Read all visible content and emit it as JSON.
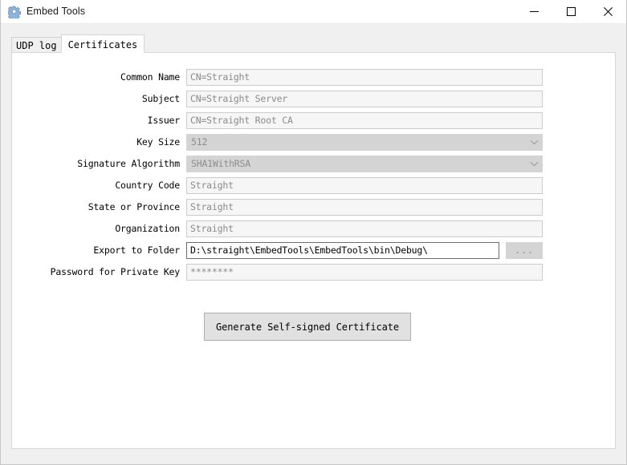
{
  "window": {
    "title": "Embed Tools",
    "icon": "gear-icon",
    "controls": {
      "minimize": "minimize-icon",
      "maximize": "maximize-icon",
      "close": "close-icon"
    }
  },
  "tabs": [
    {
      "label": "UDP log",
      "active": false
    },
    {
      "label": "Certificates",
      "active": true
    }
  ],
  "form": {
    "rows": [
      {
        "label": "Common Name",
        "type": "text",
        "value": "CN=Straight",
        "enabled": false
      },
      {
        "label": "Subject",
        "type": "text",
        "value": "CN=Straight Server",
        "enabled": false
      },
      {
        "label": "Issuer",
        "type": "text",
        "value": "CN=Straight Root CA",
        "enabled": false
      },
      {
        "label": "Key Size",
        "type": "combo",
        "value": "512",
        "enabled": false
      },
      {
        "label": "Signature Algorithm",
        "type": "combo",
        "value": "SHA1WithRSA",
        "enabled": false
      },
      {
        "label": "Country Code",
        "type": "text",
        "value": "Straight",
        "enabled": false
      },
      {
        "label": "State or Province",
        "type": "text",
        "value": "Straight",
        "enabled": false
      },
      {
        "label": "Organization",
        "type": "text",
        "value": "Straight",
        "enabled": false
      },
      {
        "label": "Export to Folder",
        "type": "path",
        "value": "D:\\straight\\EmbedTools\\EmbedTools\\bin\\Debug\\",
        "enabled": true,
        "browse_label": "..."
      },
      {
        "label": "Password for Private Key",
        "type": "password",
        "value": "********",
        "enabled": false
      }
    ],
    "generate_button": "Generate Self-signed Certificate"
  },
  "colors": {
    "window_bg": "#f0f0f0",
    "panel_bg": "#ffffff",
    "field_bg": "#f6f6f6",
    "disabled_bg": "#d4d4d4",
    "button_bg": "#e1e1e1",
    "text": "#000000",
    "disabled_text": "#8a8a8a"
  }
}
